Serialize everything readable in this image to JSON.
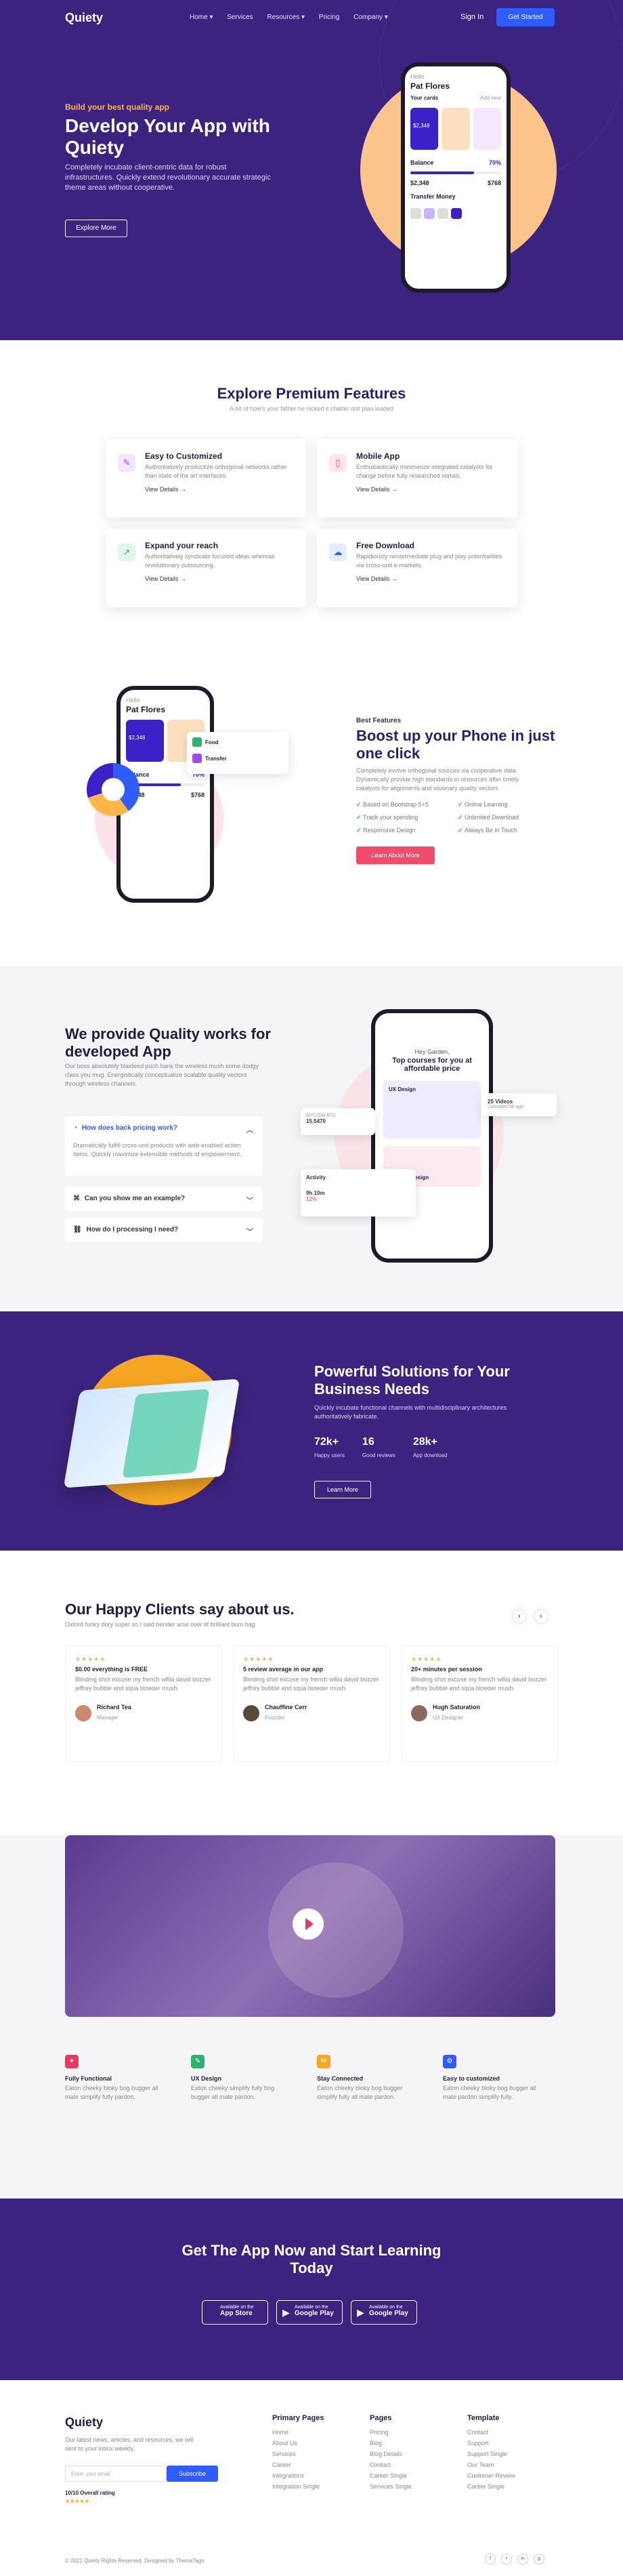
{
  "nav": {
    "logo": "Quiety",
    "links": [
      "Home ▾",
      "Services",
      "Resources ▾",
      "Pricing",
      "Company ▾"
    ],
    "signin": "Sign In",
    "cta": "Get Started"
  },
  "hero": {
    "eyebrow": "Build your best quality app",
    "title": "Develop Your App with Quiety",
    "desc": "Completely incubate client-centric data for robust infrastructures. Quickly extend revolutionary accurate strategic theme areas without cooperative.",
    "button": "Explore More",
    "phone": {
      "greeting": "Hello",
      "name": "Pat Flores",
      "cards_label": "Your cards",
      "add_new": "Add new",
      "card_amount": "$2,348",
      "balance_label": "Balance",
      "balance_pct": "70%",
      "amount_a": "$2,348",
      "amount_b": "$768",
      "transfer": "Transfer Money"
    }
  },
  "features": {
    "title": "Explore Premium Features",
    "subtitle": "A bit of how's your father he nicked it chatter doll plan loaded",
    "items": [
      {
        "title": "Easy to Customized",
        "desc": "Authoritatively productize orthogonal networks rather than state of the art interfaces.",
        "link": "View Details →",
        "icon": "✎"
      },
      {
        "title": "Mobile App",
        "desc": "Enthusiastically mesmerize integrated catalysts for change before fully researched vortals.",
        "link": "View Details →",
        "icon": "▯"
      },
      {
        "title": "Expand your reach",
        "desc": "Authoritatively syndicate focused ideas whereas revolutionary outsourcing.",
        "link": "View Details →",
        "icon": "↗"
      },
      {
        "title": "Free Download",
        "desc": "Rapidiously reintermediate plug and play potentialities via cross-unit e-markets.",
        "link": "View Details →",
        "icon": "☁"
      }
    ]
  },
  "boost": {
    "tag": "Best Features",
    "title": "Boost up your Phone in just one click",
    "desc": "Completely evolve orthogonal sources via cooperative data. Dynamically provide high standards in resources after timely catalysts for alignments and visionary quality vectors.",
    "checks": [
      "Based on Bootstrap 5+5",
      "Online Learning",
      "Track your spending",
      "Unlimited Download",
      "Responsive Design",
      "Always Be in Touch"
    ],
    "button": "Learn About More",
    "card": {
      "food": "Food",
      "transfer": "Transfer"
    }
  },
  "quality": {
    "title": "We provide Quality works for developed App",
    "desc": "Our boss absolutely blaideed puch bank the wireless mush some dodgy class you mug. Energistically conceptualize scalable quality vectors through wireless channels.",
    "accordion": [
      {
        "q": "How does back pricing work?",
        "a": "Dramatically fulfill cross-unit products with web-enabled action items. Quickly maximize extensible methods of empowerment.",
        "icon": "◔"
      },
      {
        "q": "Can you show me an example?",
        "icon": "⌘"
      },
      {
        "q": "How do I processing I need?",
        "icon": "⛓"
      }
    ],
    "phone": {
      "hey": "Hey Garden,",
      "headline": "Top courses for you at affordable price",
      "course": "UX Design",
      "course2": "Finance Design"
    },
    "float_videos": {
      "count": "25 Videos",
      "label": "Uploaded 8h ago"
    },
    "float_bitcoin": {
      "label": "BITCOIN BTC",
      "value": "15.5470"
    },
    "float_activity": {
      "title": "Activity",
      "time": "9h 10m",
      "pct": "12%"
    }
  },
  "solutions": {
    "title": "Powerful Solutions for Your Business Needs",
    "desc": "Quickly incubate functional channels with multidisciplinary architectures authoritatively fabricate.",
    "stats": [
      {
        "value": "72k+",
        "label": "Happy users"
      },
      {
        "value": "16",
        "label": "Good reviews"
      },
      {
        "value": "28k+",
        "label": "App download"
      }
    ],
    "button": "Learn More"
  },
  "testimonials": {
    "title": "Our Happy Clients say about us.",
    "subtitle": "Oxford funky dory super so I said bender arse over tit brilliant bum bag",
    "prev": "‹",
    "next": "›",
    "items": [
      {
        "stars": "★★★★★",
        "headline": "$0.00 everything is FREE",
        "text": "Blinding shot excuse my french willia david bozzer jeffrey bubble and squa bloeder mush.",
        "name": "Richard Tea",
        "role": "Manager"
      },
      {
        "stars": "★★★★★",
        "headline": "5 review average in our app",
        "text": "Blinding shot excuse my french willia david bozzer jeffrey bubble and squa bloeder mush.",
        "name": "Chauffine Cerr",
        "role": "Founder"
      },
      {
        "stars": "★★★★★",
        "headline": "20+ minutes per session",
        "text": "Blinding shot excuse my french willia david bozzer jeffrey bubble and squa bloeder mush.",
        "name": "Hugh Saturation",
        "role": "UX Designer"
      }
    ]
  },
  "mini_features": [
    {
      "title": "Fully Functional",
      "text": "Eaton cheeky bloky bog bugger all mate simplify fully pardon.",
      "icon": "✦",
      "color": "#e63a5f"
    },
    {
      "title": "UX Design",
      "text": "Eaton cheeky simplify fully bog bugger all mate pardon.",
      "icon": "✎",
      "color": "#2db36e"
    },
    {
      "title": "Stay Connected",
      "text": "Eaton cheeky bloky bog bugger simplify fully all mate pardon.",
      "icon": "✉",
      "color": "#f6a623"
    },
    {
      "title": "Easy to customized",
      "text": "Eaton cheeky bloky bog bugger all mate pardon simplify fully.",
      "icon": "⚙",
      "color": "#2f5cff"
    }
  ],
  "download": {
    "title": "Get The App Now and Start Learning Today",
    "stores": [
      {
        "small": "Available on the",
        "big": "App Store",
        "icon": ""
      },
      {
        "small": "Available on the",
        "big": "Google Play",
        "icon": "▶"
      },
      {
        "small": "Available on the",
        "big": "Google Play",
        "icon": "▶"
      }
    ]
  },
  "footer": {
    "logo": "Quiety",
    "desc": "Our latest news, articles, and resources, we will sent to your inbox weekly.",
    "placeholder": "Enter your email",
    "subscribe": "Subscribe",
    "rating": "10/10 Overall rating",
    "stars": "★★★★★",
    "columns": [
      {
        "title": "Primary Pages",
        "links": [
          "Home",
          "About Us",
          "Services",
          "Career",
          "Integrations",
          "Integration Single"
        ]
      },
      {
        "title": "Pages",
        "links": [
          "Pricing",
          "Blog",
          "Blog Details",
          "Contact",
          "Career Single",
          "Services Single"
        ]
      },
      {
        "title": "Template",
        "links": [
          "Contact",
          "Support",
          "Support Single",
          "Our Team",
          "Customer Review",
          "Career Single"
        ]
      }
    ],
    "copyright": "© 2021 Quiety Rights Reserved. Designed by ThemeTags",
    "social": [
      "f",
      "t",
      "in",
      "g"
    ]
  }
}
